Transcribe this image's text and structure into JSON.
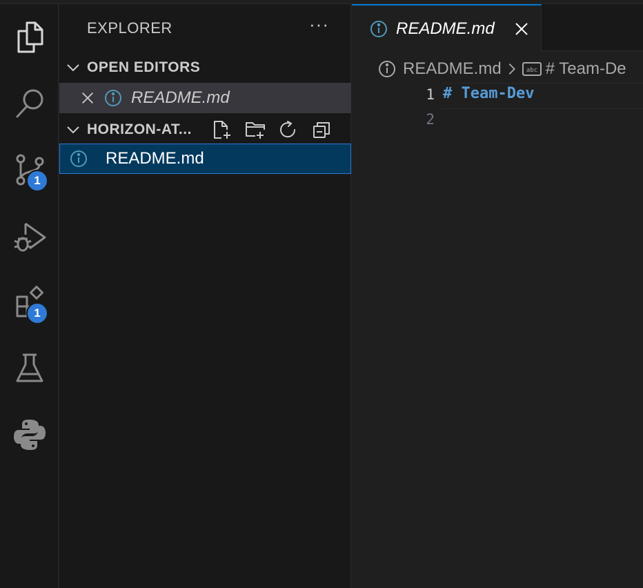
{
  "colors": {
    "accent": "#0078d4",
    "badge": "#2f7ad6",
    "selection": "#04395e",
    "markdown_heading": "#569cd6"
  },
  "activity_bar": {
    "items": [
      {
        "icon": "files-icon",
        "badge": ""
      },
      {
        "icon": "search-icon",
        "badge": ""
      },
      {
        "icon": "source-control-icon",
        "badge": "1"
      },
      {
        "icon": "run-debug-icon",
        "badge": ""
      },
      {
        "icon": "extensions-icon",
        "badge": "1"
      },
      {
        "icon": "testing-flask-icon",
        "badge": ""
      },
      {
        "icon": "python-icon",
        "badge": ""
      }
    ]
  },
  "sidebar": {
    "title": "EXPLORER",
    "more": "···",
    "open_editors": {
      "label": "OPEN EDITORS",
      "items": [
        {
          "name": "README.md"
        }
      ]
    },
    "folder": {
      "label": "HORIZON-AT...",
      "items": [
        {
          "name": "README.md"
        }
      ]
    }
  },
  "editor": {
    "tab": {
      "name": "README.md"
    },
    "breadcrumb": {
      "file": "README.md",
      "symbol": "# Team-De"
    },
    "lines": [
      {
        "number": "1",
        "text": "# Team-Dev"
      },
      {
        "number": "2",
        "text": ""
      }
    ]
  }
}
